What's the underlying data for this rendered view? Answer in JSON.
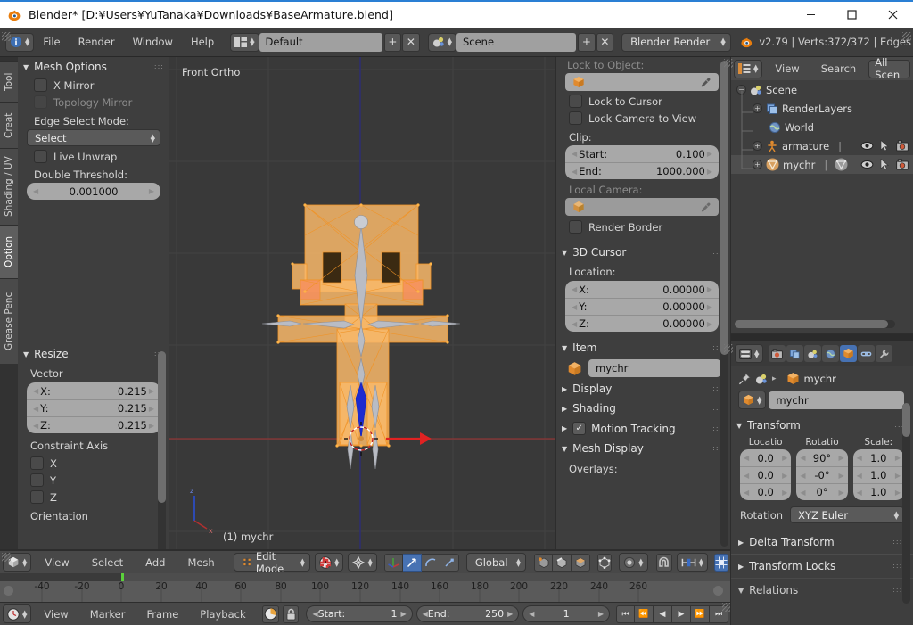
{
  "window": {
    "title": "Blender* [D:¥Users¥YuTanaka¥Downloads¥BaseArmature.blend]",
    "app_icon": "blender-logo-icon",
    "minimize": "–",
    "maximize": "□",
    "close": "✕"
  },
  "topbar": {
    "editor_icon": "info-editor-icon",
    "menus": [
      "File",
      "Render",
      "Window",
      "Help"
    ],
    "screen_layout_icon": "screen-layout-icon",
    "screen_layout": "Default",
    "add_layout": "+",
    "remove_layout": "✕",
    "scene_icon": "scene-icon",
    "scene": "Scene",
    "add_scene": "+",
    "remove_scene": "✕",
    "render_engine": "Blender Render",
    "status": "v2.79 | Verts:372/372 | Edges"
  },
  "left_tabs": [
    {
      "label": "Tool",
      "active": false
    },
    {
      "label": "Creat",
      "active": false
    },
    {
      "label": "Shading / UV",
      "active": false
    },
    {
      "label": "Option",
      "active": true
    },
    {
      "label": "Grease Penc",
      "active": false
    }
  ],
  "mesh_options": {
    "title": "Mesh Options",
    "x_mirror": "X Mirror",
    "topology_mirror": "Topology Mirror",
    "edge_select_mode_label": "Edge Select Mode:",
    "edge_select_mode_value": "Select",
    "live_unwrap": "Live Unwrap",
    "double_threshold_label": "Double Threshold:",
    "double_threshold_value": "0.001000"
  },
  "resize_panel": {
    "title": "Resize",
    "vector_label": "Vector",
    "vector": [
      {
        "label": "X:",
        "value": "0.215"
      },
      {
        "label": "Y:",
        "value": "0.215"
      },
      {
        "label": "Z:",
        "value": "0.215"
      }
    ],
    "constraint_axis_label": "Constraint Axis",
    "axes": [
      "X",
      "Y",
      "Z"
    ],
    "orientation_label": "Orientation"
  },
  "viewport": {
    "view_label": "Front Ortho",
    "object_label": "(1) mychr",
    "axis_x": "x",
    "axis_z": "z"
  },
  "n_panel": {
    "lock_to_object_label": "Lock to Object:",
    "lock_to_object_value": "",
    "eyedropper_icon": "eyedropper-icon",
    "lock_to_cursor": "Lock to Cursor",
    "lock_camera_to_view": "Lock Camera to View",
    "clip_label": "Clip:",
    "clip_start_label": "Start:",
    "clip_start_value": "0.100",
    "clip_end_label": "End:",
    "clip_end_value": "1000.000",
    "local_camera_label": "Local Camera:",
    "render_border": "Render Border",
    "cursor_title": "3D Cursor",
    "location_label": "Location:",
    "cursor": [
      {
        "label": "X:",
        "value": "0.00000"
      },
      {
        "label": "Y:",
        "value": "0.00000"
      },
      {
        "label": "Z:",
        "value": "0.00000"
      }
    ],
    "item_title": "Item",
    "item_name": "mychr",
    "display_title": "Display",
    "shading_title": "Shading",
    "motion_tracking_title": "Motion Tracking",
    "mesh_display_title": "Mesh Display",
    "overlays_label": "Overlays:"
  },
  "outliner": {
    "editor_icon": "outliner-editor-icon",
    "menus": [
      "View",
      "Search"
    ],
    "display_mode": "All Scen",
    "rows": [
      {
        "name": "Scene",
        "icon": "scene-icon",
        "indent": 0,
        "expander": "−",
        "selected": false
      },
      {
        "name": "RenderLayers",
        "icon": "renderlayers-icon",
        "indent": 1,
        "expander": "+",
        "selected": false
      },
      {
        "name": "World",
        "icon": "world-icon",
        "indent": 1,
        "expander": "",
        "selected": false
      },
      {
        "name": "armature",
        "icon": "armature-icon",
        "indent": 1,
        "expander": "+",
        "selected": false
      },
      {
        "name": "mychr",
        "icon": "mesh-data-icon",
        "indent": 1,
        "expander": "+",
        "selected": true
      }
    ],
    "row_toggles": [
      "eye-icon",
      "cursor-arrow-icon",
      "camera-icon"
    ]
  },
  "properties": {
    "editor_icon": "properties-editor-icon",
    "tabs": [
      {
        "name": "render-tab",
        "icon": "camera-back-icon",
        "active": false
      },
      {
        "name": "render-layers-tab",
        "icon": "images-icon",
        "active": false
      },
      {
        "name": "scene-tab",
        "icon": "scene-icon",
        "active": false
      },
      {
        "name": "world-tab",
        "icon": "world-icon",
        "active": false
      },
      {
        "name": "object-tab",
        "icon": "object-cube-icon",
        "active": true
      },
      {
        "name": "constraints-tab",
        "icon": "chain-icon",
        "active": false
      },
      {
        "name": "modifiers-tab",
        "icon": "wrench-icon",
        "active": false
      }
    ],
    "pin_icon": "pin-icon",
    "breadcrumb_scene_icon": "scene-icon",
    "breadcrumb_separator": "▸",
    "breadcrumb_object": "mychr",
    "object_name_field": "mychr",
    "transform_title": "Transform",
    "columns": [
      "Locatio",
      "Rotatio",
      "Scale:"
    ],
    "location": [
      "0.0",
      "0.0",
      "0.0"
    ],
    "rotation": [
      "90°",
      "-0°",
      "0°"
    ],
    "scale": [
      "1.0",
      "1.0",
      "1.0"
    ],
    "rotation_mode_label": "Rotation",
    "rotation_mode_value": "XYZ Euler",
    "delta_transform": "Delta Transform",
    "transform_locks": "Transform Locks",
    "relations": "Relations"
  },
  "viewport_header": {
    "editor_icon": "view3d-editor-icon",
    "menus": [
      "View",
      "Select",
      "Add",
      "Mesh"
    ],
    "mode_icon": "edit-mode-icon",
    "mode": "Edit Mode",
    "shading_icon": "texture-shading-icon",
    "pivot_icon": "pivot-median-icon",
    "select_modes": [
      "manipulator-icon",
      "translate-icon",
      "rotate-icon",
      "scale-icon"
    ],
    "orientation": "Global",
    "mesh_select_modes": [
      "vertex-select-icon",
      "edge-select-icon",
      "face-select-icon"
    ],
    "proportional_edit_icon": "proportional-edit-icon",
    "occlude_icon": "limit-selection-icon",
    "snap_icon": "magnet-icon",
    "snap_target_icon": "snap-target-icon",
    "snap_element_icon": "snap-grid-icon"
  },
  "timeline": {
    "editor_icon": "timeline-editor-icon",
    "menus": [
      "View",
      "Marker",
      "Frame",
      "Playback"
    ],
    "sync_icon": "sync-icon",
    "lock_icon": "lock-icon",
    "start_label": "Start:",
    "start_value": "1",
    "end_label": "End:",
    "end_value": "250",
    "current_frame": "1",
    "playhead_frame": 0,
    "ticks": [
      -40,
      -20,
      0,
      20,
      40,
      60,
      80,
      100,
      120,
      140,
      160,
      180,
      200,
      220,
      240,
      260
    ],
    "transport": [
      "⏮",
      "⏪",
      "◀",
      "▶",
      "⏩",
      "⏭"
    ]
  },
  "colors": {
    "accent_blue": "#4772b3",
    "mesh_selected": "#f2a13c",
    "header_bg": "#484848",
    "panel_bg": "#3e3e3e",
    "viewport_bg": "#393939",
    "green_playhead": "#5bd13b",
    "x_axis_red": "#9a3b3b",
    "z_axis_blue": "#2b2b7a"
  }
}
